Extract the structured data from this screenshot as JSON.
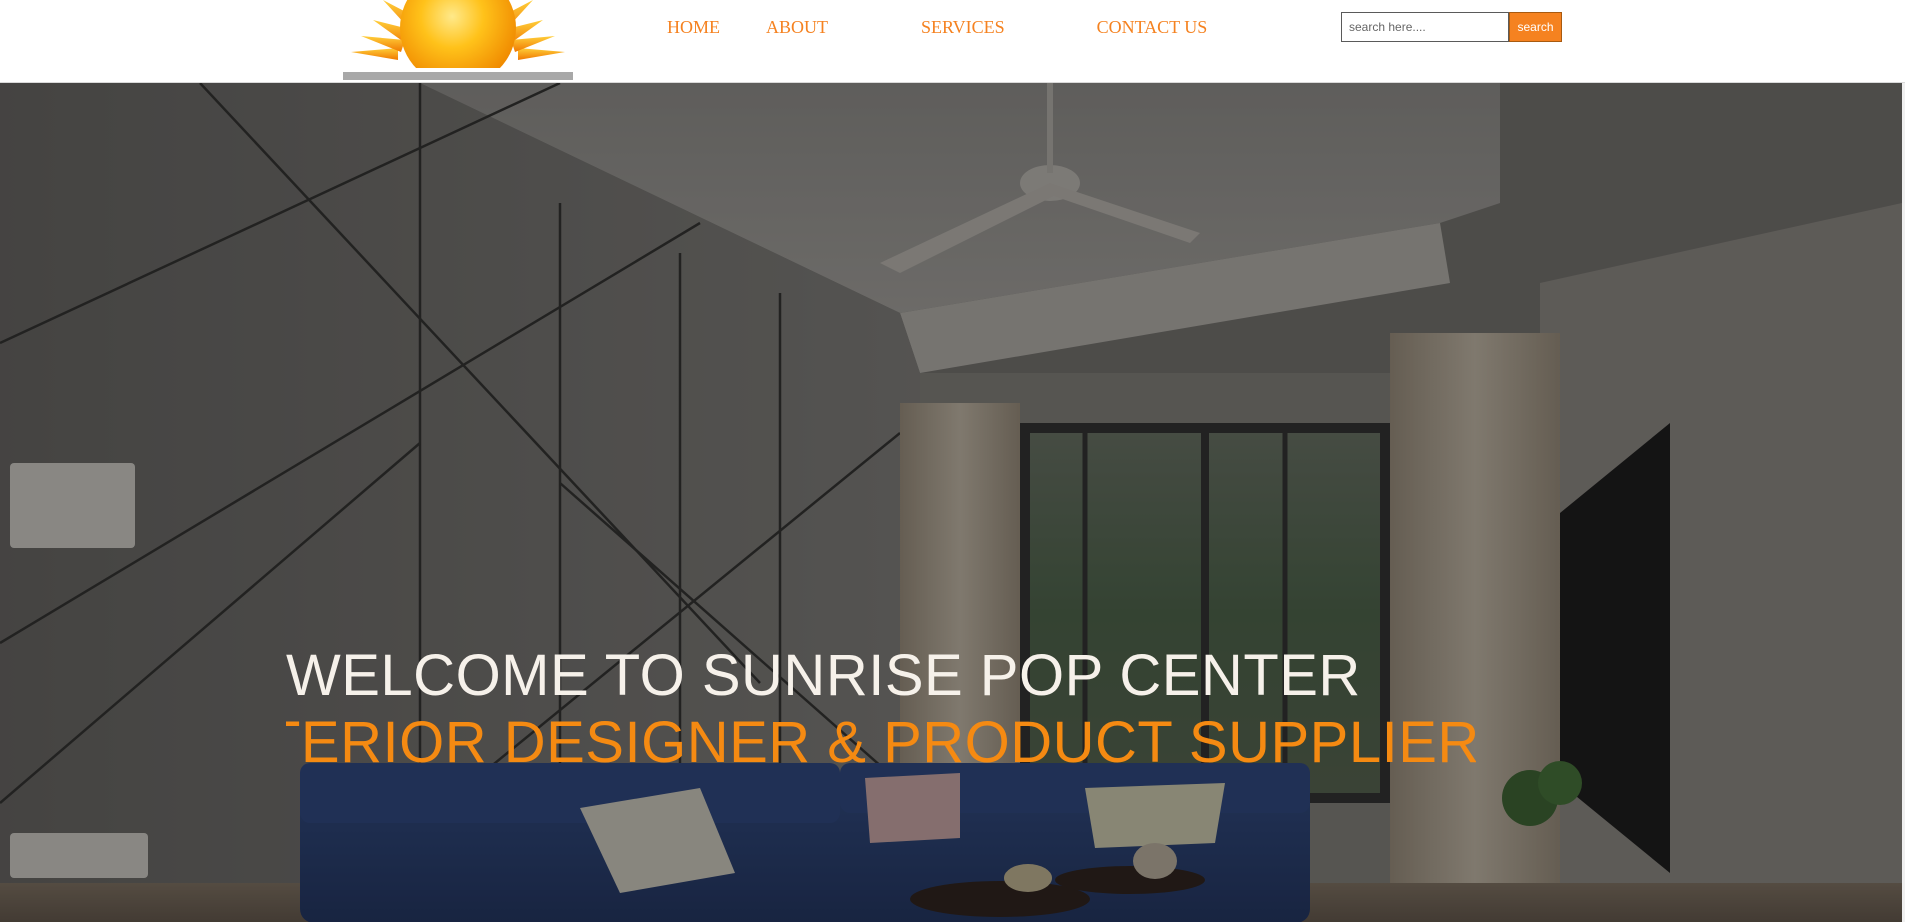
{
  "nav": {
    "items": [
      {
        "label": "HOME"
      },
      {
        "label": "ABOUT"
      },
      {
        "label": "SERVICES"
      },
      {
        "label": "CONTACT US"
      }
    ]
  },
  "search": {
    "placeholder": "search here....",
    "value": "",
    "button_label": "search"
  },
  "hero": {
    "line1": "WELCOME TO SUNRISE POP CENTER",
    "line2": "INTERIOR DESIGNER & PRODUCT SUPPLIERS."
  },
  "colors": {
    "accent": "#f58220",
    "hero_heading": "#f6f1ea",
    "hero_subheading": "#f58a12"
  },
  "icons": {
    "logo": "sun-logo"
  }
}
